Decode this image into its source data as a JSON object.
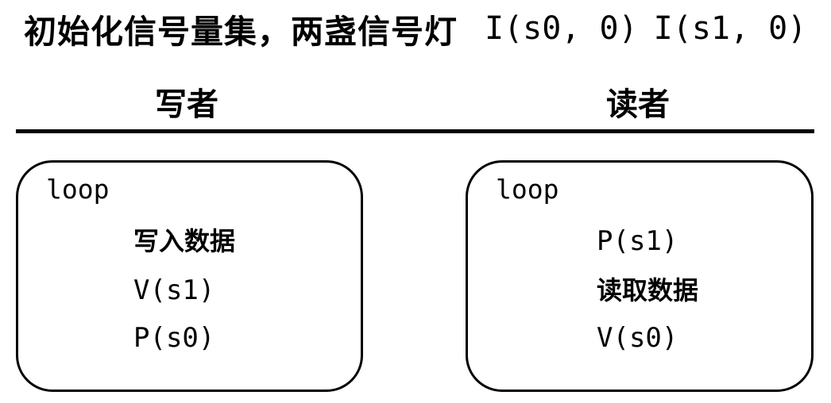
{
  "heading": {
    "text": "初始化信号量集，两盏信号灯",
    "init_s0": "I(s0, 0)",
    "init_s1": "I(s1, 0)"
  },
  "writer": {
    "title": "写者",
    "loop_label": "loop",
    "steps": [
      "写入数据",
      "V(s1)",
      "P(s0)"
    ]
  },
  "reader": {
    "title": "读者",
    "loop_label": "loop",
    "steps": [
      "P(s1)",
      "读取数据",
      "V(s0)"
    ]
  }
}
